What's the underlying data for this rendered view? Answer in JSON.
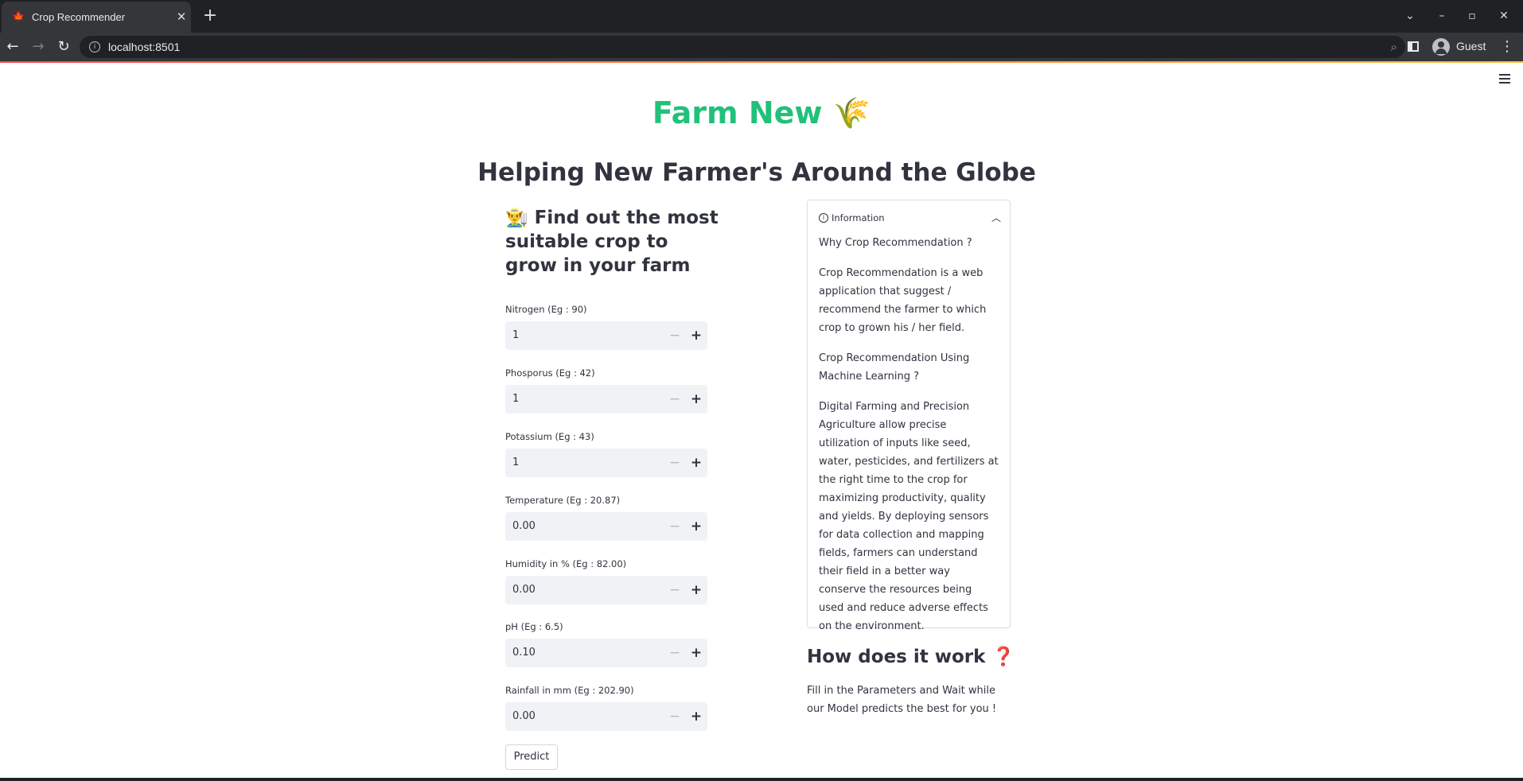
{
  "browser": {
    "tab_title": "Crop Recommender",
    "tab_favicon": "maple-leaf-icon",
    "url": "localhost:8501",
    "profile_name": "Guest"
  },
  "app": {
    "title": "Farm New",
    "title_emoji": "🌾",
    "title_color": "#21c17a",
    "subtitle": "Helping New Farmer's Around the Globe",
    "find_heading": "👨‍🌾 Find out the most suitable crop to grow in your farm",
    "fields": [
      {
        "label": "Nitrogen (Eg : 90)",
        "value": "1"
      },
      {
        "label": "Phosporus (Eg : 42)",
        "value": "1"
      },
      {
        "label": "Potassium (Eg : 43)",
        "value": "1"
      },
      {
        "label": "Temperature (Eg : 20.87)",
        "value": "0.00"
      },
      {
        "label": "Humidity in % (Eg : 82.00)",
        "value": "0.00"
      },
      {
        "label": "pH (Eg : 6.5)",
        "value": "0.10"
      },
      {
        "label": "Rainfall in mm (Eg : 202.90)",
        "value": "0.00"
      }
    ],
    "predict_label": "Predict",
    "info": {
      "title": "Information",
      "paragraphs": [
        "Why Crop Recommendation ?",
        "Crop Recommendation is a web application that suggest / recommend the farmer to which crop to grown his / her field.",
        "Crop Recommendation Using Machine Learning ?",
        "Digital Farming and Precision Agriculture allow precise utilization of inputs like seed, water, pesticides, and fertilizers at the right time to the crop for maximizing productivity, quality and yields. By deploying sensors for data collection and mapping fields, farmers can understand their field in a better way conserve the resources being used and reduce adverse effects on the environment."
      ]
    },
    "how_heading": "How does it work ❓",
    "how_text": "Fill in the Parameters and Wait while our Model predicts the best for you !"
  }
}
